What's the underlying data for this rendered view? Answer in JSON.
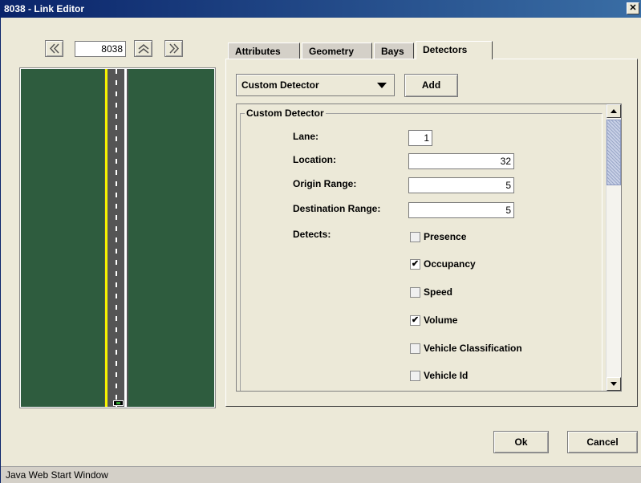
{
  "window": {
    "title": "8038 - Link Editor",
    "close_glyph": "✕"
  },
  "nav": {
    "link_id": "8038"
  },
  "tabs": [
    {
      "label": "Attributes"
    },
    {
      "label": "Geometry"
    },
    {
      "label": "Bays"
    },
    {
      "label": "Detectors"
    }
  ],
  "detectors": {
    "type_selected": "Custom Detector",
    "add_label": "Add",
    "group_title": "Custom Detector",
    "lane_label": "Lane:",
    "lane_value": "1",
    "location_label": "Location:",
    "location_value": "32",
    "origin_label": "Origin Range:",
    "origin_value": "5",
    "destination_label": "Destination Range:",
    "destination_value": "5",
    "detects_label": "Detects:",
    "options": [
      {
        "label": "Presence",
        "checked": false
      },
      {
        "label": "Occupancy",
        "checked": true
      },
      {
        "label": "Speed",
        "checked": false
      },
      {
        "label": "Volume",
        "checked": true
      },
      {
        "label": "Vehicle Classification",
        "checked": false
      },
      {
        "label": "Vehicle Id",
        "checked": false
      }
    ]
  },
  "footer": {
    "ok_label": "Ok",
    "cancel_label": "Cancel"
  },
  "status": {
    "text": "Java Web Start Window"
  },
  "colors": {
    "title_start": "#0a246a",
    "title_end": "#3a6ea5",
    "grass": "#2e5c3e",
    "asphalt": "#555555",
    "center_line": "#f4f400"
  },
  "icons": {
    "prev": "double-chevron-left-icon",
    "up": "double-chevron-up-icon",
    "next": "double-chevron-right-icon",
    "check": "✔"
  }
}
